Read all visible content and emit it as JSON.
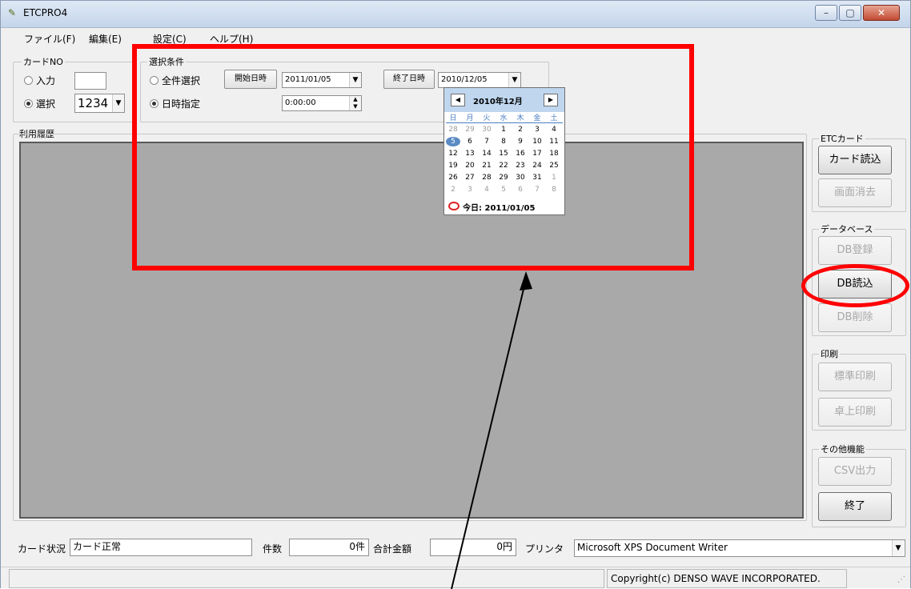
{
  "window": {
    "title": "ETCPRO4",
    "minimize": "–",
    "maximize": "▢",
    "close": "✕"
  },
  "menu": [
    "ファイル(F)",
    "編集(E)",
    "設定(C)",
    "ヘルプ(H)"
  ],
  "card_no": {
    "group_label": "カードNO",
    "input_label": "入力",
    "input_value": "",
    "select_label": "選択",
    "select_value": "1234"
  },
  "selection": {
    "group_label": "選択条件",
    "all_label": "全件選択",
    "datetime_label": "日時指定",
    "start_button": "開始日時",
    "start_date": "2011/01/05",
    "start_time": "0:00:00",
    "end_button": "終了日時",
    "end_date": "2010/12/05"
  },
  "calendar": {
    "title": "2010年12月",
    "prev": "◀",
    "next": "▶",
    "weekdays": [
      "日",
      "月",
      "火",
      "水",
      "木",
      "金",
      "土"
    ],
    "weeks": [
      [
        "28",
        "29",
        "30",
        "1",
        "2",
        "3",
        "4"
      ],
      [
        "5",
        "6",
        "7",
        "8",
        "9",
        "10",
        "11"
      ],
      [
        "12",
        "13",
        "14",
        "15",
        "16",
        "17",
        "18"
      ],
      [
        "19",
        "20",
        "21",
        "22",
        "23",
        "24",
        "25"
      ],
      [
        "26",
        "27",
        "28",
        "29",
        "30",
        "31",
        "1"
      ],
      [
        "2",
        "3",
        "4",
        "5",
        "6",
        "7",
        "8"
      ]
    ],
    "today": "今日: 2011/01/05"
  },
  "history_label": "利用履歴",
  "etc_card": {
    "group_label": "ETCカード",
    "read_button": "カード読込",
    "clear_button": "画面消去"
  },
  "database": {
    "group_label": "データベース",
    "register_button": "DB登録",
    "load_button": "DB読込",
    "delete_button": "DB削除"
  },
  "print": {
    "group_label": "印刷",
    "standard_button": "標準印刷",
    "desktop_button": "卓上印刷"
  },
  "other": {
    "group_label": "その他機能",
    "csv_button": "CSV出力",
    "exit_button": "終了"
  },
  "status": {
    "card_status_label": "カード状況",
    "card_status_value": "カード正常",
    "count_label": "件数",
    "count_value": "0件",
    "total_label": "合計金額",
    "total_value": "0円",
    "printer_label": "プリンタ",
    "printer_value": "Microsoft XPS Document Writer",
    "copyright": "Copyright(c) DENSO WAVE INCORPORATED."
  }
}
